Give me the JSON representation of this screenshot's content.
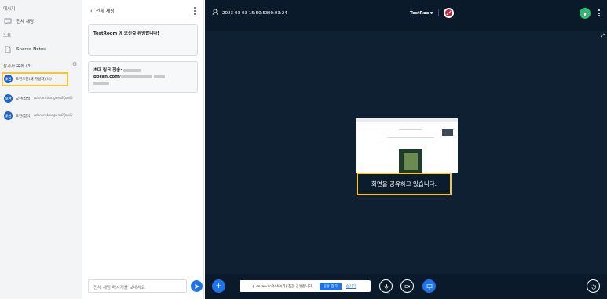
{
  "left_panel": {
    "messages_title": "메시지",
    "public_chat_label": "전체 채팅",
    "notes_title": "노트",
    "shared_notes_label": "Shared Notes",
    "participants_title": "참가자 목록 (3)",
    "participants": [
      {
        "avatar": "오한",
        "name": "오한오한(채 가설자)(나)",
        "extra": ""
      },
      {
        "avatar": "오한",
        "name": "오한(참석)",
        "extra": "(doran-bodgem8fpb8)"
      },
      {
        "avatar": "오한",
        "name": "오한(참석)",
        "extra": "(doran-bodgem8fpb8)"
      }
    ]
  },
  "chat": {
    "back_label": "전체 채팅",
    "welcome_room": "TestRoom",
    "welcome_text": "에 오신걸 환영합니다!",
    "invite_title": "초대 링크 전송: ",
    "invite_domain": "doran.com/",
    "input_placeholder": "전체 채팅 메시지를 보내세요"
  },
  "topbar": {
    "datetime": "2023-03-03 15:50:53",
    "elapsed": "00:03:24",
    "room_name": "TestRoom"
  },
  "screen_share": {
    "label": "화면을 공유하고 있습니다."
  },
  "bottombar": {
    "notice_text": "g-doran.kr:9443(가) 창을 공유합니다.",
    "stop_share_label": "공유 중지",
    "hide_label": "숨기기"
  },
  "colors": {
    "accent": "#1f73e8",
    "highlight": "#f7c23c",
    "main_bg": "#0e2032",
    "topbar_bg": "#0b1a2a"
  },
  "icons": [
    "chat-icon",
    "note-icon",
    "gear-icon",
    "send-icon",
    "participants-icon",
    "recording-off-icon",
    "signal-icon",
    "kebab-icon",
    "expand-icon",
    "plus-icon",
    "mic-icon",
    "camera-icon",
    "screen-share-icon",
    "hand-icon"
  ]
}
